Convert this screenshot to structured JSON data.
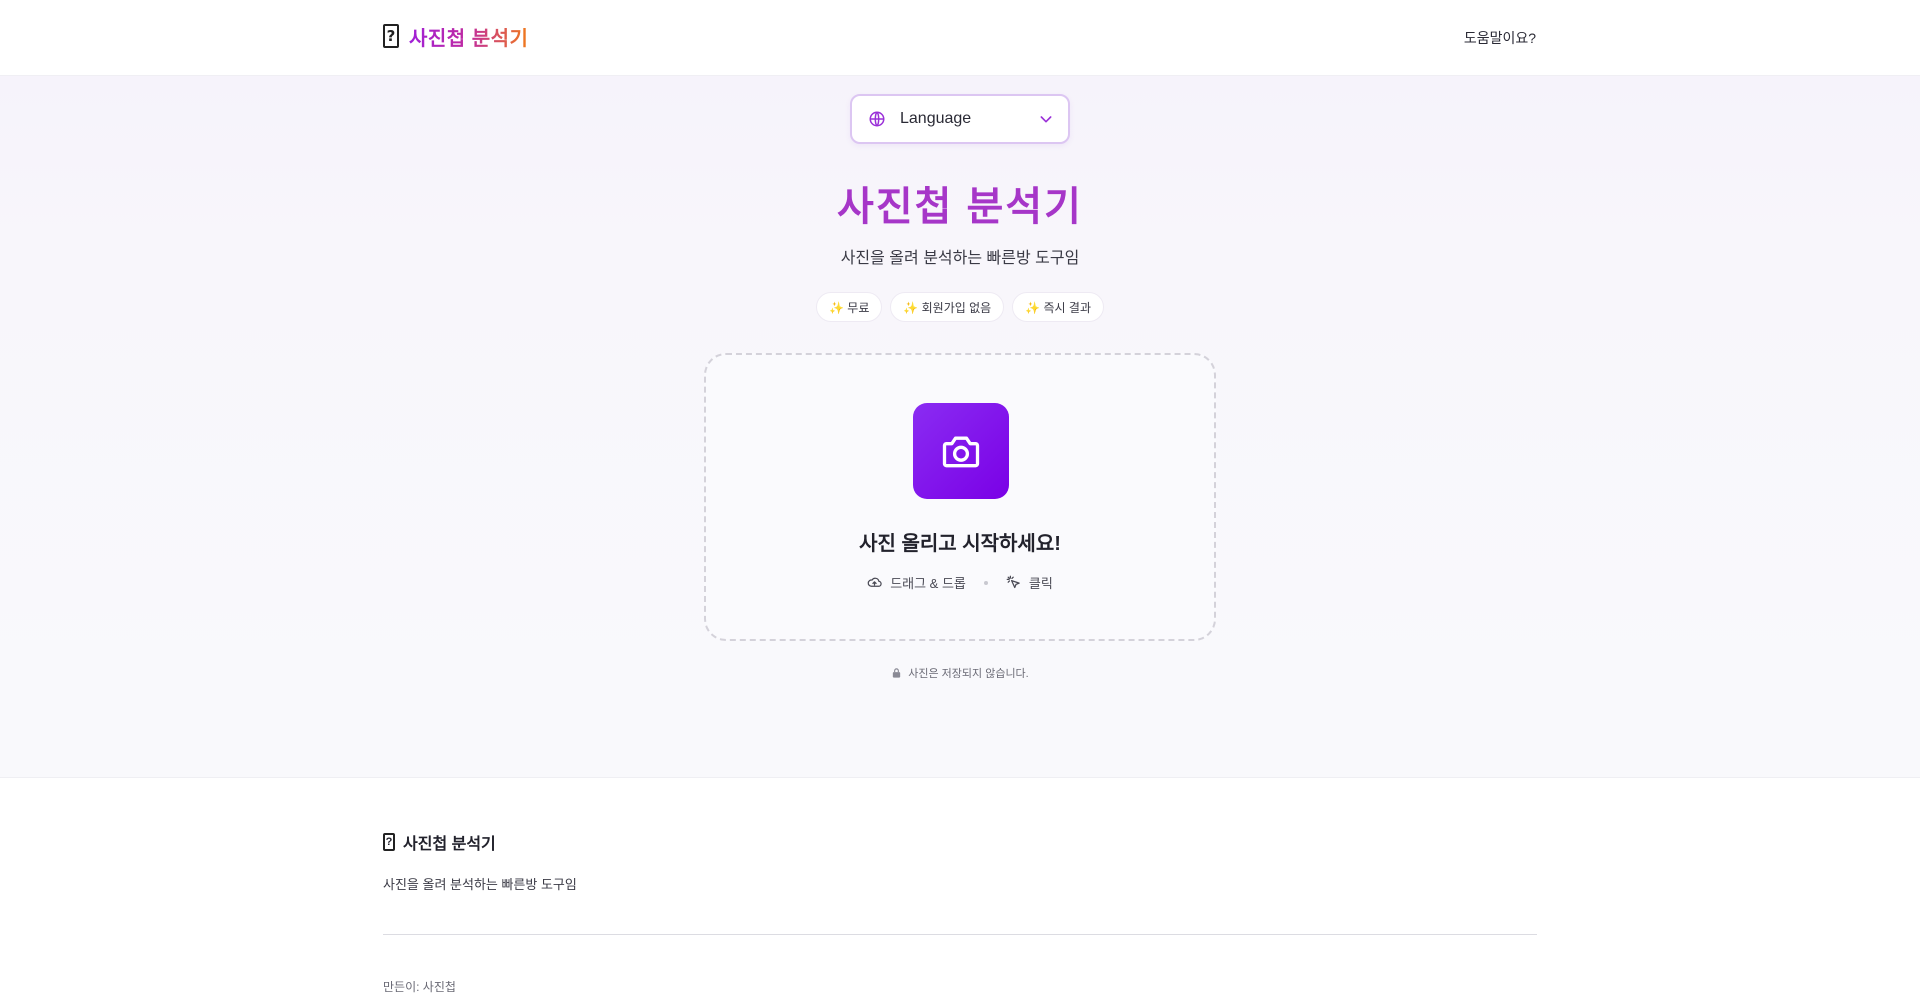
{
  "header": {
    "brand_icon": "?",
    "brand_name": "사진첩 분석기",
    "help_label": "도움말이요?"
  },
  "language": {
    "label": "Language"
  },
  "hero": {
    "title": "사진첩 분석기",
    "subtitle": "사진을 올려 분석하는 빠른방 도구임",
    "chips": [
      {
        "label": "✨ 무료"
      },
      {
        "label": "✨ 회원가입 없음"
      },
      {
        "label": "✨ 즉시 결과"
      }
    ]
  },
  "dropzone": {
    "title": "사진 올리고 시작하세요!",
    "meta": [
      {
        "icon": "cloud-upload-icon",
        "label": "드래그 & 드롭"
      },
      {
        "icon": "click-icon",
        "label": "클릭"
      }
    ],
    "icon": "camera-icon"
  },
  "privacy": {
    "text": "사진은 저장되지 않습니다."
  },
  "footer": {
    "icon": "?",
    "title": "사진첩 분석기",
    "desc": "사진을 올려 분석하는 빠른방 도구임",
    "meta": "만든이: 사진첩"
  },
  "colors": {
    "accent": "#a636c8",
    "camera_tile": "#8a2cf2",
    "brand_gradient_end": "#f07a1a"
  }
}
